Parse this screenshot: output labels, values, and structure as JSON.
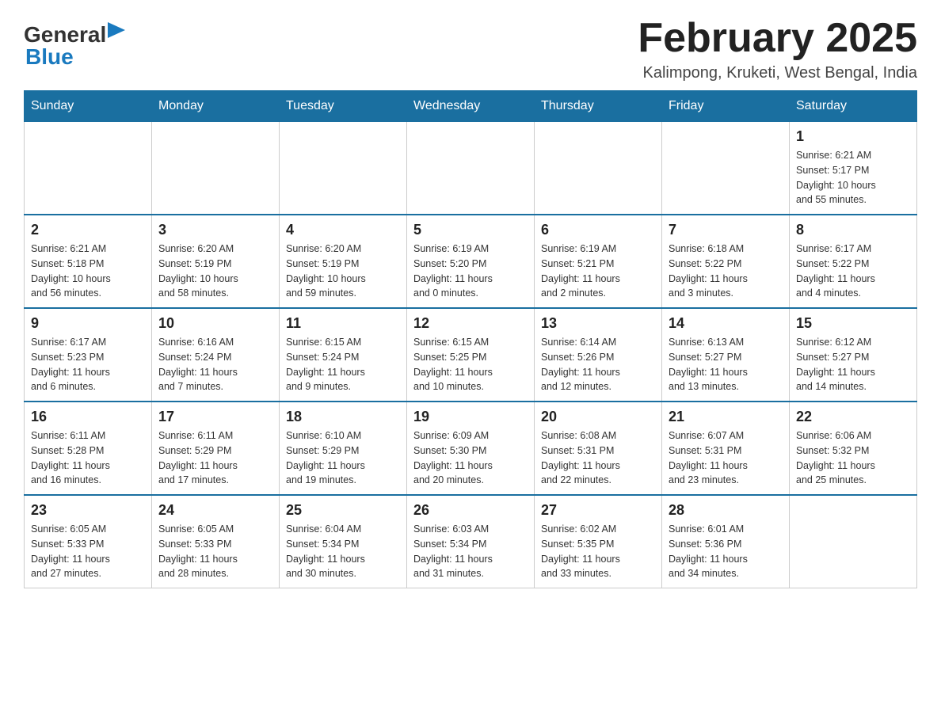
{
  "header": {
    "logo_general": "General",
    "logo_blue": "Blue",
    "month_title": "February 2025",
    "location": "Kalimpong, Kruketi, West Bengal, India"
  },
  "days_of_week": [
    "Sunday",
    "Monday",
    "Tuesday",
    "Wednesday",
    "Thursday",
    "Friday",
    "Saturday"
  ],
  "weeks": [
    [
      {
        "day": "",
        "info": ""
      },
      {
        "day": "",
        "info": ""
      },
      {
        "day": "",
        "info": ""
      },
      {
        "day": "",
        "info": ""
      },
      {
        "day": "",
        "info": ""
      },
      {
        "day": "",
        "info": ""
      },
      {
        "day": "1",
        "info": "Sunrise: 6:21 AM\nSunset: 5:17 PM\nDaylight: 10 hours\nand 55 minutes."
      }
    ],
    [
      {
        "day": "2",
        "info": "Sunrise: 6:21 AM\nSunset: 5:18 PM\nDaylight: 10 hours\nand 56 minutes."
      },
      {
        "day": "3",
        "info": "Sunrise: 6:20 AM\nSunset: 5:19 PM\nDaylight: 10 hours\nand 58 minutes."
      },
      {
        "day": "4",
        "info": "Sunrise: 6:20 AM\nSunset: 5:19 PM\nDaylight: 10 hours\nand 59 minutes."
      },
      {
        "day": "5",
        "info": "Sunrise: 6:19 AM\nSunset: 5:20 PM\nDaylight: 11 hours\nand 0 minutes."
      },
      {
        "day": "6",
        "info": "Sunrise: 6:19 AM\nSunset: 5:21 PM\nDaylight: 11 hours\nand 2 minutes."
      },
      {
        "day": "7",
        "info": "Sunrise: 6:18 AM\nSunset: 5:22 PM\nDaylight: 11 hours\nand 3 minutes."
      },
      {
        "day": "8",
        "info": "Sunrise: 6:17 AM\nSunset: 5:22 PM\nDaylight: 11 hours\nand 4 minutes."
      }
    ],
    [
      {
        "day": "9",
        "info": "Sunrise: 6:17 AM\nSunset: 5:23 PM\nDaylight: 11 hours\nand 6 minutes."
      },
      {
        "day": "10",
        "info": "Sunrise: 6:16 AM\nSunset: 5:24 PM\nDaylight: 11 hours\nand 7 minutes."
      },
      {
        "day": "11",
        "info": "Sunrise: 6:15 AM\nSunset: 5:24 PM\nDaylight: 11 hours\nand 9 minutes."
      },
      {
        "day": "12",
        "info": "Sunrise: 6:15 AM\nSunset: 5:25 PM\nDaylight: 11 hours\nand 10 minutes."
      },
      {
        "day": "13",
        "info": "Sunrise: 6:14 AM\nSunset: 5:26 PM\nDaylight: 11 hours\nand 12 minutes."
      },
      {
        "day": "14",
        "info": "Sunrise: 6:13 AM\nSunset: 5:27 PM\nDaylight: 11 hours\nand 13 minutes."
      },
      {
        "day": "15",
        "info": "Sunrise: 6:12 AM\nSunset: 5:27 PM\nDaylight: 11 hours\nand 14 minutes."
      }
    ],
    [
      {
        "day": "16",
        "info": "Sunrise: 6:11 AM\nSunset: 5:28 PM\nDaylight: 11 hours\nand 16 minutes."
      },
      {
        "day": "17",
        "info": "Sunrise: 6:11 AM\nSunset: 5:29 PM\nDaylight: 11 hours\nand 17 minutes."
      },
      {
        "day": "18",
        "info": "Sunrise: 6:10 AM\nSunset: 5:29 PM\nDaylight: 11 hours\nand 19 minutes."
      },
      {
        "day": "19",
        "info": "Sunrise: 6:09 AM\nSunset: 5:30 PM\nDaylight: 11 hours\nand 20 minutes."
      },
      {
        "day": "20",
        "info": "Sunrise: 6:08 AM\nSunset: 5:31 PM\nDaylight: 11 hours\nand 22 minutes."
      },
      {
        "day": "21",
        "info": "Sunrise: 6:07 AM\nSunset: 5:31 PM\nDaylight: 11 hours\nand 23 minutes."
      },
      {
        "day": "22",
        "info": "Sunrise: 6:06 AM\nSunset: 5:32 PM\nDaylight: 11 hours\nand 25 minutes."
      }
    ],
    [
      {
        "day": "23",
        "info": "Sunrise: 6:05 AM\nSunset: 5:33 PM\nDaylight: 11 hours\nand 27 minutes."
      },
      {
        "day": "24",
        "info": "Sunrise: 6:05 AM\nSunset: 5:33 PM\nDaylight: 11 hours\nand 28 minutes."
      },
      {
        "day": "25",
        "info": "Sunrise: 6:04 AM\nSunset: 5:34 PM\nDaylight: 11 hours\nand 30 minutes."
      },
      {
        "day": "26",
        "info": "Sunrise: 6:03 AM\nSunset: 5:34 PM\nDaylight: 11 hours\nand 31 minutes."
      },
      {
        "day": "27",
        "info": "Sunrise: 6:02 AM\nSunset: 5:35 PM\nDaylight: 11 hours\nand 33 minutes."
      },
      {
        "day": "28",
        "info": "Sunrise: 6:01 AM\nSunset: 5:36 PM\nDaylight: 11 hours\nand 34 minutes."
      },
      {
        "day": "",
        "info": ""
      }
    ]
  ]
}
